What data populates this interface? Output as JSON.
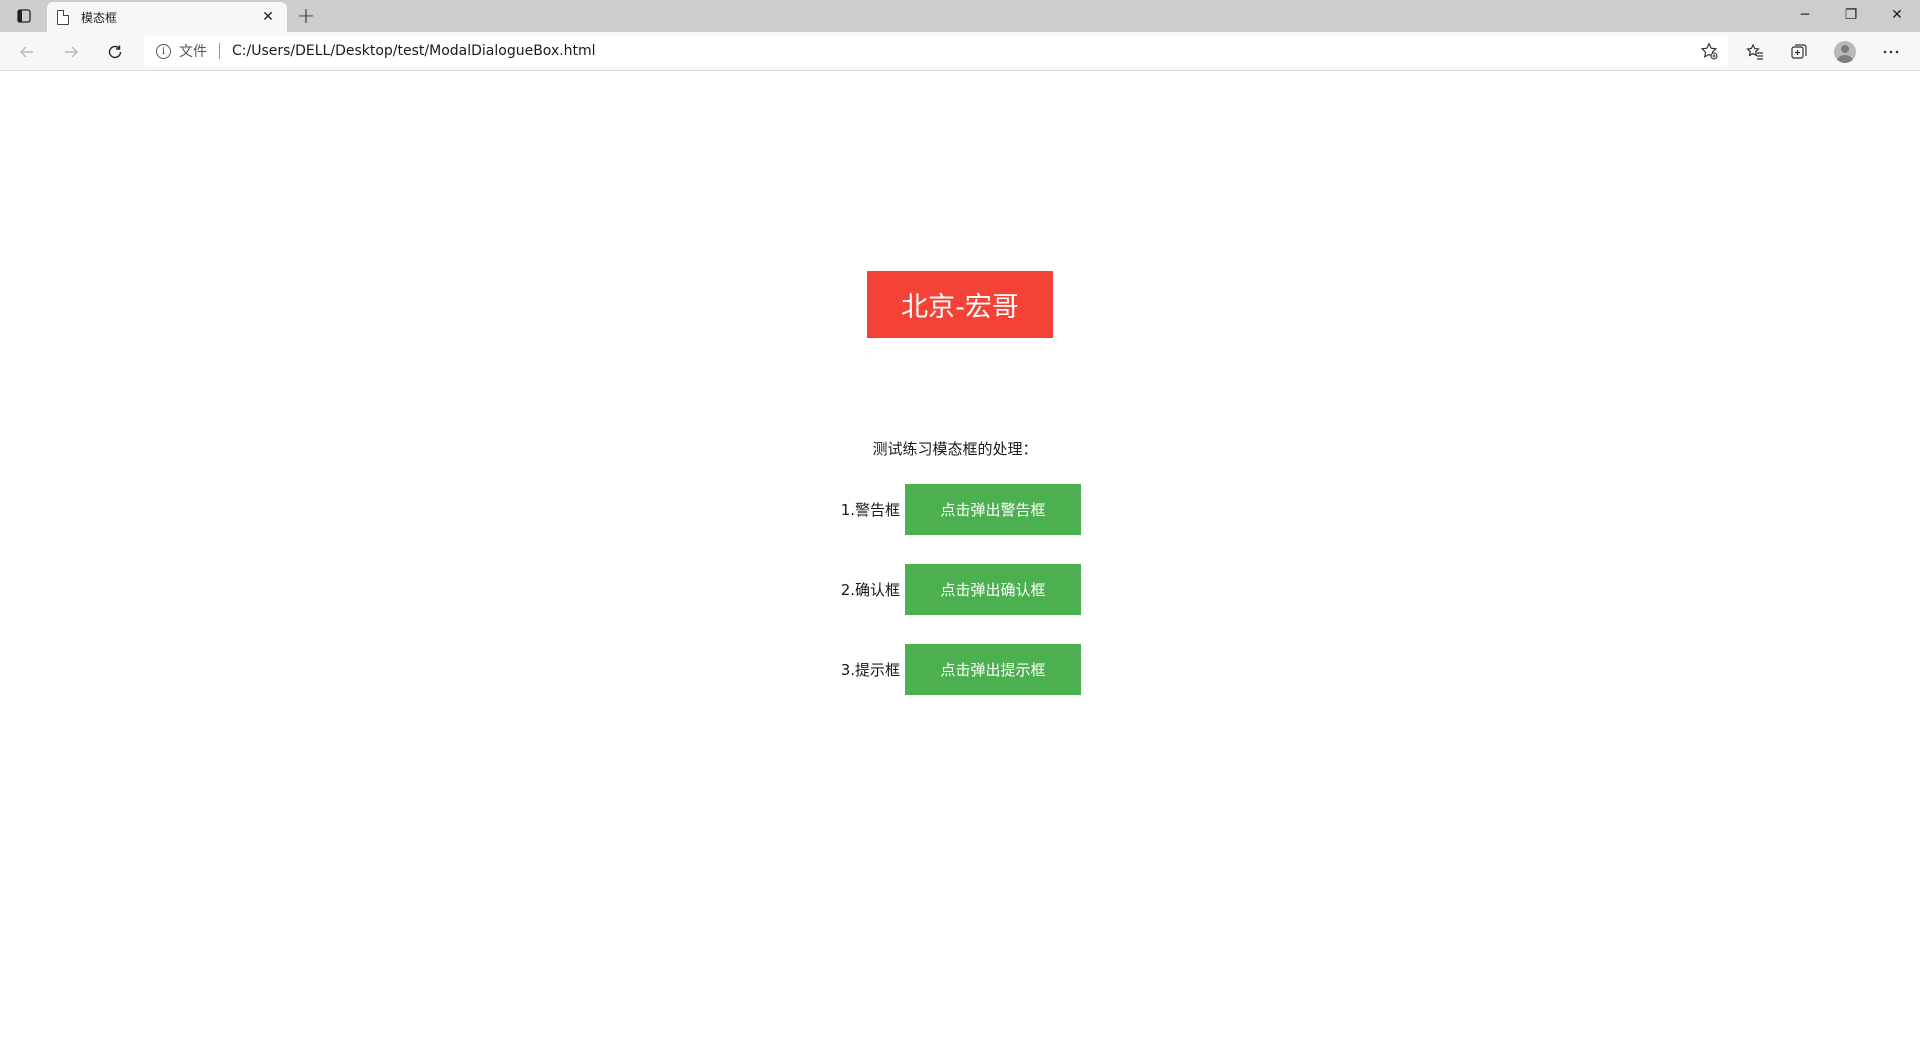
{
  "browser": {
    "tab_title": "模态框",
    "tab_close": "✕",
    "new_tab": "+",
    "site_label": "文件",
    "url": "C:/Users/DELL/Desktop/test/ModalDialogueBox.html",
    "window_controls": {
      "minimize": "─",
      "restore": "❐",
      "close": "✕"
    }
  },
  "page": {
    "brand": "北京-宏哥",
    "intro": "测试练习模态框的处理：",
    "rows": [
      {
        "label": "1.警告框",
        "button": "点击弹出警告框"
      },
      {
        "label": "2.确认框",
        "button": "点击弹出确认框"
      },
      {
        "label": "3.提示框",
        "button": "点击弹出提示框"
      }
    ]
  },
  "colors": {
    "brand_bg": "#f44336",
    "button_bg": "#4caf50",
    "button_text": "#ffffff"
  }
}
